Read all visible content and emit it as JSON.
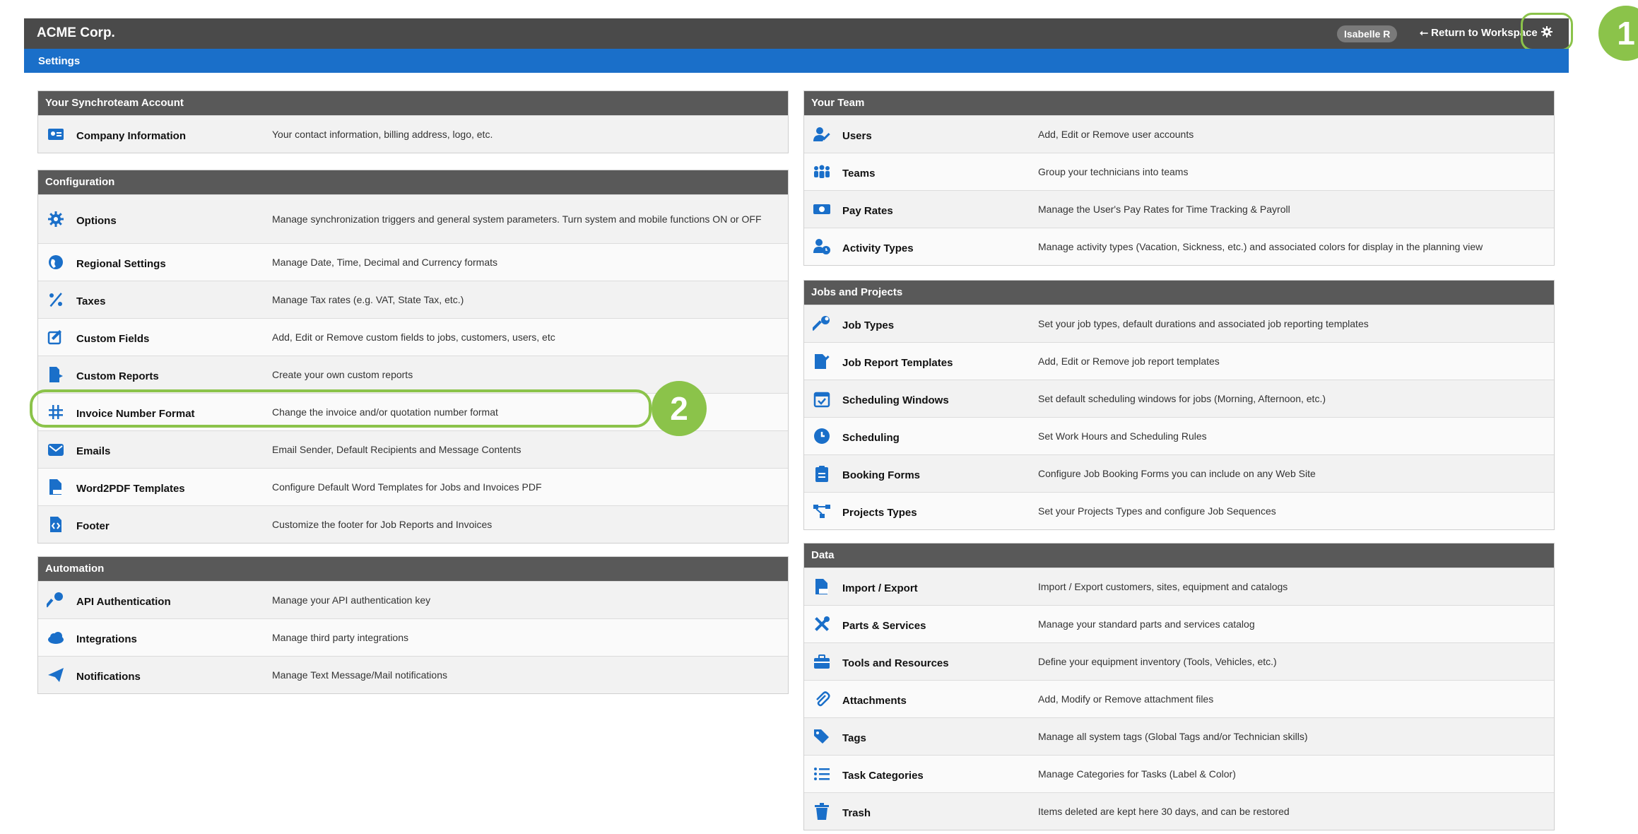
{
  "header": {
    "app_title": "ACME Corp.",
    "user_name": "Isabelle R",
    "return_label": "⭠ Return to Workspace",
    "settings_icon": "gear-icon"
  },
  "subheader": {
    "title": "Settings"
  },
  "callouts": {
    "one": "1",
    "two": "2"
  },
  "colors": {
    "accent": "#8bc34a",
    "brand": "#1a6fc9",
    "icon": "#1a6fc9",
    "header": "#4a4a4a",
    "section": "#595959"
  },
  "left": {
    "account": {
      "title": "Your Synchroteam Account",
      "items": [
        {
          "name": "Company Information",
          "desc": "Your contact information, billing address, logo, etc.",
          "icon": "id-card-icon"
        }
      ]
    },
    "configuration": {
      "title": "Configuration",
      "items": [
        {
          "name": "Options",
          "desc": "Manage synchronization triggers and general system parameters. Turn system and mobile functions ON or OFF",
          "icon": "gear-icon"
        },
        {
          "name": "Regional Settings",
          "desc": "Manage Date, Time, Decimal and Currency formats",
          "icon": "globe-icon"
        },
        {
          "name": "Taxes",
          "desc": "Manage Tax rates (e.g. VAT, State Tax, etc.)",
          "icon": "percent-icon"
        },
        {
          "name": "Custom Fields",
          "desc": "Add, Edit or Remove custom fields to jobs, customers, users, etc",
          "icon": "edit-icon"
        },
        {
          "name": "Custom Reports",
          "desc": "Create your own custom reports",
          "icon": "file-export-icon"
        },
        {
          "name": "Invoice Number Format",
          "desc": "Change the invoice and/or quotation number format",
          "icon": "hashtag-icon"
        },
        {
          "name": "Emails",
          "desc": "Email Sender, Default Recipients and Message Contents",
          "icon": "envelope-icon"
        },
        {
          "name": "Word2PDF Templates",
          "desc": "Configure Default Word Templates for Jobs and Invoices PDF",
          "icon": "pdf-file-icon"
        },
        {
          "name": "Footer",
          "desc": "Customize the footer for Job Reports and Invoices",
          "icon": "file-code-icon"
        }
      ]
    },
    "automation": {
      "title": "Automation",
      "items": [
        {
          "name": "API Authentication",
          "desc": "Manage your API authentication key",
          "icon": "key-icon"
        },
        {
          "name": "Integrations",
          "desc": "Manage third party integrations",
          "icon": "cloud-icon"
        },
        {
          "name": "Notifications",
          "desc": "Manage Text Message/Mail notifications",
          "icon": "paper-plane-icon"
        }
      ]
    }
  },
  "right": {
    "team": {
      "title": "Your Team",
      "items": [
        {
          "name": "Users",
          "desc": "Add, Edit or Remove user accounts",
          "icon": "user-edit-icon"
        },
        {
          "name": "Teams",
          "desc": "Group your technicians into teams",
          "icon": "team-icon"
        },
        {
          "name": "Pay Rates",
          "desc": "Manage the User's Pay Rates for Time Tracking & Payroll",
          "icon": "money-bill-icon"
        },
        {
          "name": "Activity Types",
          "desc": "Manage activity types (Vacation, Sickness, etc.) and associated colors for display in the planning view",
          "icon": "user-clock-icon"
        }
      ]
    },
    "jobs": {
      "title": "Jobs and Projects",
      "items": [
        {
          "name": "Job Types",
          "desc": "Set your job types, default durations and associated job reporting templates",
          "icon": "wrench-icon"
        },
        {
          "name": "Job Report Templates",
          "desc": "Add, Edit or Remove job report templates",
          "icon": "file-signature-icon"
        },
        {
          "name": "Scheduling Windows",
          "desc": "Set default scheduling windows for jobs (Morning, Afternoon, etc.)",
          "icon": "calendar-check-icon"
        },
        {
          "name": "Scheduling",
          "desc": "Set Work Hours and Scheduling Rules",
          "icon": "clock-icon"
        },
        {
          "name": "Booking Forms",
          "desc": "Configure Job Booking Forms you can include on any Web Site",
          "icon": "clipboard-icon"
        },
        {
          "name": "Projects Types",
          "desc": "Set your Projects Types and configure Job Sequences",
          "icon": "project-diagram-icon"
        }
      ]
    },
    "data": {
      "title": "Data",
      "items": [
        {
          "name": "Import / Export",
          "desc": "Import / Export customers, sites, equipment and catalogs",
          "icon": "csv-file-icon"
        },
        {
          "name": "Parts & Services",
          "desc": "Manage your standard parts and services catalog",
          "icon": "tools-icon"
        },
        {
          "name": "Tools and Resources",
          "desc": "Define your equipment inventory (Tools, Vehicles, etc.)",
          "icon": "toolbox-icon"
        },
        {
          "name": "Attachments",
          "desc": "Add, Modify or Remove attachment files",
          "icon": "paperclip-icon"
        },
        {
          "name": "Tags",
          "desc": "Manage all system tags (Global Tags and/or Technician skills)",
          "icon": "tags-icon"
        },
        {
          "name": "Task Categories",
          "desc": "Manage Categories for Tasks (Label & Color)",
          "icon": "list-icon"
        },
        {
          "name": "Trash",
          "desc": "Items deleted are kept here 30 days, and can be restored",
          "icon": "trash-icon"
        }
      ]
    }
  }
}
